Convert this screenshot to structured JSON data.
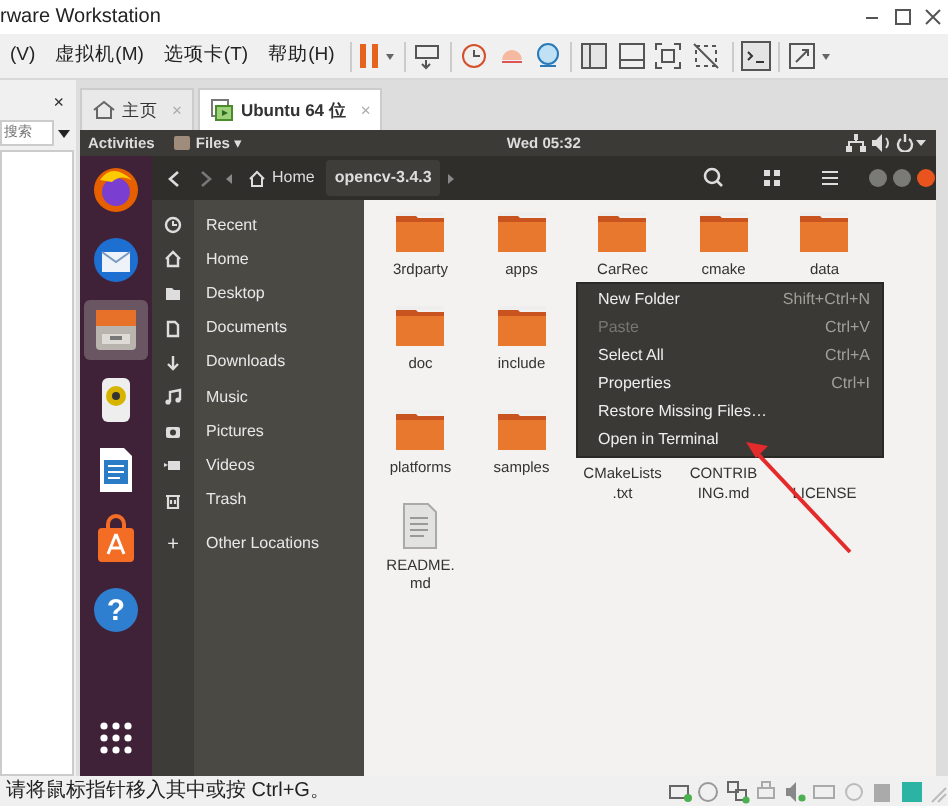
{
  "window": {
    "title": "rware Workstation"
  },
  "menu": [
    "(V)",
    "虚拟机(M)",
    "选项卡(T)",
    "帮助(H)"
  ],
  "library": {
    "close": "×",
    "search": {
      "placeholder": "搜索"
    }
  },
  "tabs": [
    {
      "label": "主页",
      "kind": "home",
      "selected": false,
      "close": "×"
    },
    {
      "label": "Ubuntu 64 位",
      "kind": "vm",
      "selected": true,
      "close": "×"
    }
  ],
  "top_bar": {
    "activities": "Activities",
    "app": "Files ▾",
    "clock": "Wed 05:32"
  },
  "header": {
    "path": [
      {
        "label": "Home",
        "kind": "home",
        "selected": false
      },
      {
        "label": "opencv-3.4.3",
        "kind": "folder",
        "selected": true
      }
    ]
  },
  "dock": [
    {
      "kind": "browser",
      "active": false
    },
    {
      "kind": "mail",
      "active": false
    },
    {
      "kind": "files",
      "active": true
    },
    {
      "kind": "music",
      "active": false
    },
    {
      "kind": "writer",
      "active": false
    },
    {
      "kind": "store",
      "active": false
    },
    {
      "kind": "help",
      "active": false,
      "glyph": "?"
    },
    {
      "kind": "apps",
      "active": false
    }
  ],
  "sidebar": [
    {
      "label": "Recent",
      "kind": "recent"
    },
    {
      "label": "Home",
      "kind": "home"
    },
    {
      "label": "Desktop",
      "kind": "desktop"
    },
    {
      "label": "Documents",
      "kind": "documents"
    },
    {
      "label": "Downloads",
      "kind": "downloads"
    },
    {
      "label": "Music",
      "kind": "music"
    },
    {
      "label": "Pictures",
      "kind": "pictures"
    },
    {
      "label": "Videos",
      "kind": "videos"
    },
    {
      "label": "Trash",
      "kind": "trash"
    },
    {
      "label": "Other Locations",
      "kind": "other",
      "glyph": "+"
    }
  ],
  "files": [
    {
      "label": [
        "3rdparty"
      ],
      "kind": "folder"
    },
    {
      "label": [
        "apps"
      ],
      "kind": "folder"
    },
    {
      "label": [
        "CarRec"
      ],
      "kind": "folder"
    },
    {
      "label": [
        "cmake"
      ],
      "kind": "folder"
    },
    {
      "label": [
        "data"
      ],
      "kind": "folder"
    },
    {
      "label": [
        "doc"
      ],
      "kind": "folder"
    },
    {
      "label": [
        "include"
      ],
      "kind": "folder"
    },
    {
      "kind": "covered"
    },
    {
      "kind": "covered"
    },
    {
      "kind": "covered"
    },
    {
      "label": [
        "platforms"
      ],
      "kind": "folder"
    },
    {
      "label": [
        "samples"
      ],
      "kind": "folder"
    },
    {
      "label": [
        "CMakeLists",
        ".txt"
      ],
      "kind": "covered"
    },
    {
      "label": [
        "CONTRIB",
        "ING.md"
      ],
      "kind": "covered"
    },
    {
      "label": [
        "LICENSE"
      ],
      "kind": "covered"
    },
    {
      "label": [
        "README.",
        "md"
      ],
      "kind": "document"
    }
  ],
  "context_menu": [
    {
      "label": "New Folder",
      "shortcut": "Shift+Ctrl+N",
      "disabled": false
    },
    {
      "label": "Paste",
      "shortcut": "Ctrl+V",
      "disabled": true
    },
    {
      "label": "Select All",
      "shortcut": "Ctrl+A",
      "disabled": false
    },
    {
      "label": "Properties",
      "shortcut": "Ctrl+I",
      "disabled": false
    },
    {
      "label": "Restore Missing Files…",
      "disabled": false
    },
    {
      "label": "Open in Terminal",
      "disabled": false
    }
  ],
  "status_bar": {
    "message": "请将鼠标指针移入其中或按 Ctrl+G。"
  }
}
